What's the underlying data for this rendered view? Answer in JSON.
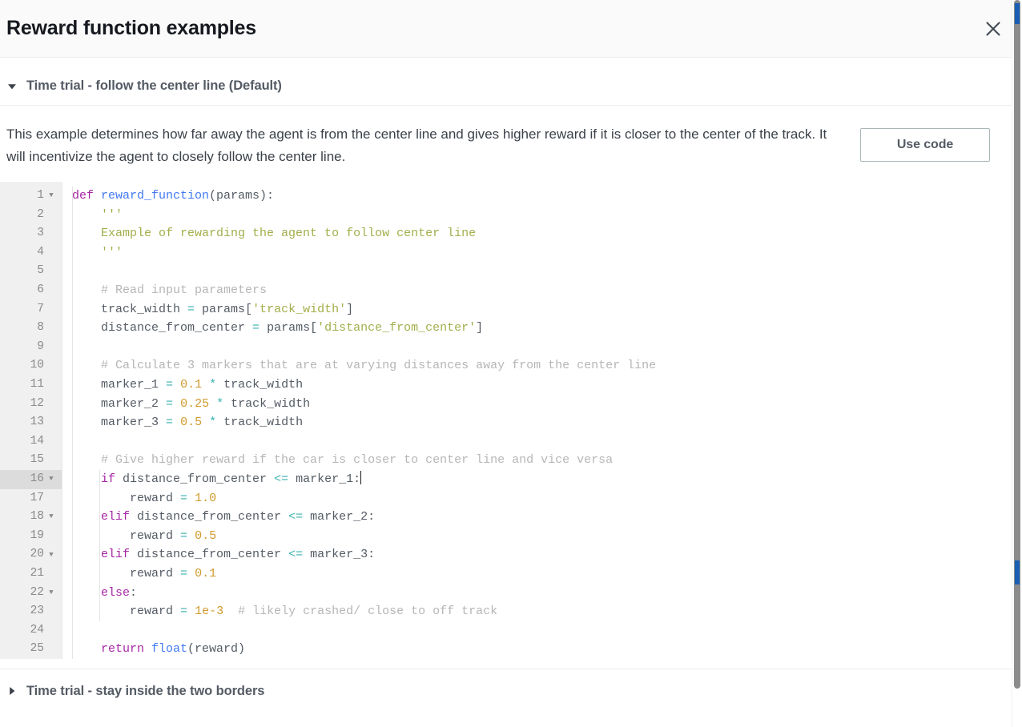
{
  "modal": {
    "title": "Reward function examples",
    "close_icon": "close-icon"
  },
  "sections": [
    {
      "label": "Time trial - follow the center line (Default)",
      "caret_icon": "caret-down-icon",
      "expanded": "true",
      "description": "This example determines how far away the agent is from the center line and gives higher reward if it is closer to the center of the track. It will incentivize the agent to closely follow the center line.",
      "use_code_label": "Use code"
    },
    {
      "label": "Time trial - stay inside the two borders",
      "caret_icon": "caret-right-icon",
      "expanded": "false"
    }
  ],
  "editor": {
    "language": "python",
    "active_line": 16,
    "cursor_line": 16,
    "gutter": [
      {
        "num": "1",
        "fold": "true"
      },
      {
        "num": "2",
        "fold": "false"
      },
      {
        "num": "3",
        "fold": "false"
      },
      {
        "num": "4",
        "fold": "false"
      },
      {
        "num": "5",
        "fold": "false"
      },
      {
        "num": "6",
        "fold": "false"
      },
      {
        "num": "7",
        "fold": "false"
      },
      {
        "num": "8",
        "fold": "false"
      },
      {
        "num": "9",
        "fold": "false"
      },
      {
        "num": "10",
        "fold": "false"
      },
      {
        "num": "11",
        "fold": "false"
      },
      {
        "num": "12",
        "fold": "false"
      },
      {
        "num": "13",
        "fold": "false"
      },
      {
        "num": "14",
        "fold": "false"
      },
      {
        "num": "15",
        "fold": "false"
      },
      {
        "num": "16",
        "fold": "true"
      },
      {
        "num": "17",
        "fold": "false"
      },
      {
        "num": "18",
        "fold": "true"
      },
      {
        "num": "19",
        "fold": "false"
      },
      {
        "num": "20",
        "fold": "true"
      },
      {
        "num": "21",
        "fold": "false"
      },
      {
        "num": "22",
        "fold": "true"
      },
      {
        "num": "23",
        "fold": "false"
      },
      {
        "num": "24",
        "fold": "false"
      },
      {
        "num": "25",
        "fold": "false"
      }
    ],
    "lines": [
      [
        {
          "t": "def ",
          "c": "kw"
        },
        {
          "t": "reward_function",
          "c": "fn"
        },
        {
          "t": "(params):",
          "c": "plain"
        }
      ],
      [
        {
          "t": "    ",
          "c": "plain"
        },
        {
          "t": "'''",
          "c": "str"
        }
      ],
      [
        {
          "t": "    ",
          "c": "plain"
        },
        {
          "t": "Example of rewarding the agent to follow center line",
          "c": "str"
        }
      ],
      [
        {
          "t": "    ",
          "c": "plain"
        },
        {
          "t": "'''",
          "c": "str"
        }
      ],
      [
        {
          "t": "",
          "c": "plain"
        }
      ],
      [
        {
          "t": "    ",
          "c": "plain"
        },
        {
          "t": "# Read input parameters",
          "c": "com"
        }
      ],
      [
        {
          "t": "    track_width ",
          "c": "plain"
        },
        {
          "t": "=",
          "c": "op"
        },
        {
          "t": " params[",
          "c": "plain"
        },
        {
          "t": "'track_width'",
          "c": "str"
        },
        {
          "t": "]",
          "c": "plain"
        }
      ],
      [
        {
          "t": "    distance_from_center ",
          "c": "plain"
        },
        {
          "t": "=",
          "c": "op"
        },
        {
          "t": " params[",
          "c": "plain"
        },
        {
          "t": "'distance_from_center'",
          "c": "str"
        },
        {
          "t": "]",
          "c": "plain"
        }
      ],
      [
        {
          "t": "",
          "c": "plain"
        }
      ],
      [
        {
          "t": "    ",
          "c": "plain"
        },
        {
          "t": "# Calculate 3 markers that are at varying distances away from the center line",
          "c": "com"
        }
      ],
      [
        {
          "t": "    marker_1 ",
          "c": "plain"
        },
        {
          "t": "=",
          "c": "op"
        },
        {
          "t": " ",
          "c": "plain"
        },
        {
          "t": "0.1",
          "c": "num"
        },
        {
          "t": " ",
          "c": "plain"
        },
        {
          "t": "*",
          "c": "op"
        },
        {
          "t": " track_width",
          "c": "plain"
        }
      ],
      [
        {
          "t": "    marker_2 ",
          "c": "plain"
        },
        {
          "t": "=",
          "c": "op"
        },
        {
          "t": " ",
          "c": "plain"
        },
        {
          "t": "0.25",
          "c": "num"
        },
        {
          "t": " ",
          "c": "plain"
        },
        {
          "t": "*",
          "c": "op"
        },
        {
          "t": " track_width",
          "c": "plain"
        }
      ],
      [
        {
          "t": "    marker_3 ",
          "c": "plain"
        },
        {
          "t": "=",
          "c": "op"
        },
        {
          "t": " ",
          "c": "plain"
        },
        {
          "t": "0.5",
          "c": "num"
        },
        {
          "t": " ",
          "c": "plain"
        },
        {
          "t": "*",
          "c": "op"
        },
        {
          "t": " track_width",
          "c": "plain"
        }
      ],
      [
        {
          "t": "",
          "c": "plain"
        }
      ],
      [
        {
          "t": "    ",
          "c": "plain"
        },
        {
          "t": "# Give higher reward if the car is closer to center line and vice versa",
          "c": "com"
        }
      ],
      [
        {
          "t": "    ",
          "c": "plain"
        },
        {
          "t": "if",
          "c": "kw"
        },
        {
          "t": " distance_from_center ",
          "c": "plain"
        },
        {
          "t": "<=",
          "c": "op"
        },
        {
          "t": " marker_1:",
          "c": "plain"
        }
      ],
      [
        {
          "t": "        reward ",
          "c": "plain"
        },
        {
          "t": "=",
          "c": "op"
        },
        {
          "t": " ",
          "c": "plain"
        },
        {
          "t": "1.0",
          "c": "num"
        }
      ],
      [
        {
          "t": "    ",
          "c": "plain"
        },
        {
          "t": "elif",
          "c": "kw"
        },
        {
          "t": " distance_from_center ",
          "c": "plain"
        },
        {
          "t": "<=",
          "c": "op"
        },
        {
          "t": " marker_2:",
          "c": "plain"
        }
      ],
      [
        {
          "t": "        reward ",
          "c": "plain"
        },
        {
          "t": "=",
          "c": "op"
        },
        {
          "t": " ",
          "c": "plain"
        },
        {
          "t": "0.5",
          "c": "num"
        }
      ],
      [
        {
          "t": "    ",
          "c": "plain"
        },
        {
          "t": "elif",
          "c": "kw"
        },
        {
          "t": " distance_from_center ",
          "c": "plain"
        },
        {
          "t": "<=",
          "c": "op"
        },
        {
          "t": " marker_3:",
          "c": "plain"
        }
      ],
      [
        {
          "t": "        reward ",
          "c": "plain"
        },
        {
          "t": "=",
          "c": "op"
        },
        {
          "t": " ",
          "c": "plain"
        },
        {
          "t": "0.1",
          "c": "num"
        }
      ],
      [
        {
          "t": "    ",
          "c": "plain"
        },
        {
          "t": "else",
          "c": "kw"
        },
        {
          "t": ":",
          "c": "plain"
        }
      ],
      [
        {
          "t": "        reward ",
          "c": "plain"
        },
        {
          "t": "=",
          "c": "op"
        },
        {
          "t": " ",
          "c": "plain"
        },
        {
          "t": "1e-3",
          "c": "num"
        },
        {
          "t": "  ",
          "c": "plain"
        },
        {
          "t": "# likely crashed/ close to off track",
          "c": "com"
        }
      ],
      [
        {
          "t": "",
          "c": "plain"
        }
      ],
      [
        {
          "t": "    ",
          "c": "plain"
        },
        {
          "t": "return ",
          "c": "kw"
        },
        {
          "t": "float",
          "c": "fn"
        },
        {
          "t": "(reward)",
          "c": "plain"
        }
      ]
    ]
  },
  "colors": {
    "keyword": "#a626a4",
    "function": "#4078f2",
    "string": "#a3ae4a",
    "number": "#d19a2e",
    "comment": "#b6b6b6",
    "operator": "#3ab3b0",
    "text": "#545b64",
    "gutter_bg": "#f0f0f0",
    "active_line_bg": "#dcdcdc",
    "header_bg": "#fafafa",
    "border": "#eaeded",
    "button_border": "#aab7b8"
  }
}
